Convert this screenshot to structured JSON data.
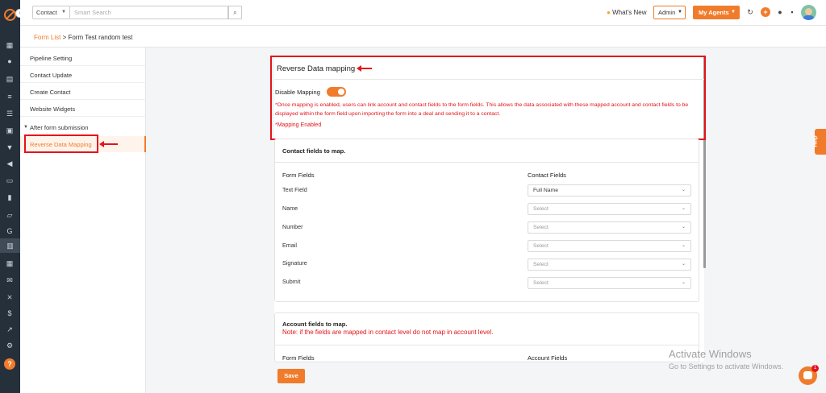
{
  "topbar": {
    "module_select": "Contact",
    "search_placeholder": "Smart Search",
    "whats_new": "What's New",
    "role_select": "Admin",
    "my_agents": "My Agents"
  },
  "breadcrumb": {
    "root": "Form List",
    "separator": " > ",
    "current": "Form Test random test"
  },
  "sidemenu": {
    "items": [
      "Pipeline Setting",
      "Contact Update",
      "Create Contact",
      "Website Widgets",
      "After form submission",
      "Reverse Data Mapping"
    ]
  },
  "reverse_mapping": {
    "title": "Reverse Data mapping",
    "toggle_label": "Disable Mapping",
    "toggle_on": true,
    "note": "*Once mapping is enabled, users can link account and contact fields to the form fields. This allows the data associated with these mapped account and contact fields to be displayed within the form field upon importing the form into a deal and sending it to a contact.",
    "status": "*Mapping Enabled"
  },
  "contact_section": {
    "title": "Contact fields to map.",
    "col_form": "Form Fields",
    "col_target": "Contact Fields",
    "rows": [
      {
        "field": "Text Field",
        "value": "Full Name"
      },
      {
        "field": "Name",
        "value": "Select"
      },
      {
        "field": "Number",
        "value": "Select"
      },
      {
        "field": "Email",
        "value": "Select"
      },
      {
        "field": "Signature",
        "value": "Select"
      },
      {
        "field": "Submit",
        "value": "Select"
      }
    ]
  },
  "account_section": {
    "title": "Account fields to map.",
    "warning": "Note: if the fields are mapped in contact level do not map in account level.",
    "col_form": "Form Fields",
    "col_target": "Account Fields"
  },
  "save_label": "Save",
  "help_label": "Help",
  "chat_badge": "1",
  "watermark": {
    "line1": "Activate Windows",
    "line2": "Go to Settings to activate Windows."
  },
  "colors": {
    "accent": "#f07c2b",
    "annotation_red": "#e3141b",
    "rail": "#25303b"
  }
}
